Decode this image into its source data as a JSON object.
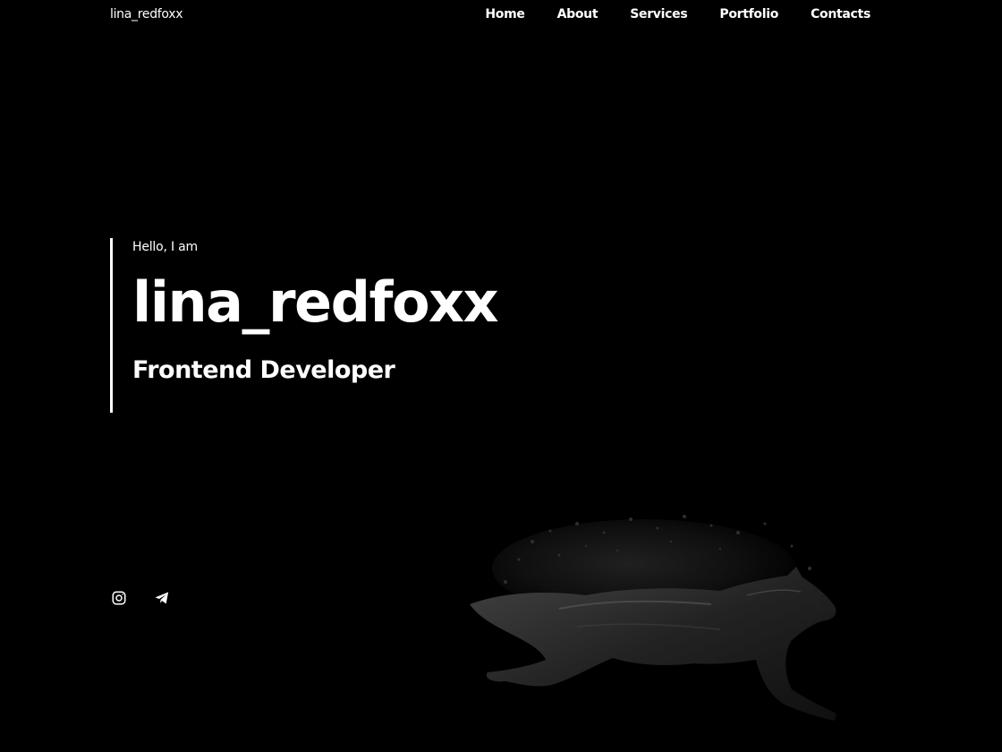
{
  "header": {
    "logo": "lina_redfoxx",
    "nav": [
      {
        "label": "Home"
      },
      {
        "label": "About"
      },
      {
        "label": "Services"
      },
      {
        "label": "Portfolio"
      },
      {
        "label": "Contacts"
      }
    ]
  },
  "hero": {
    "greeting": "Hello, I am",
    "name": "lina_redfoxx",
    "role": "Frontend Developer"
  },
  "socials": [
    {
      "icon": "instagram-icon"
    },
    {
      "icon": "telegram-icon"
    }
  ],
  "theme": {
    "background": "#000000",
    "text": "#ffffff"
  }
}
